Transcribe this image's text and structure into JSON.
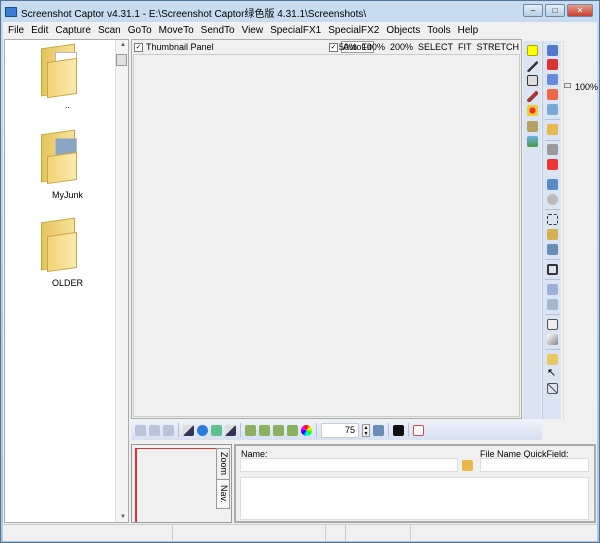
{
  "window": {
    "title": "Screenshot Captor v4.31.1 - E:\\Screenshot Captor绿色版 4.31.1\\Screenshots\\",
    "minimize": "–",
    "maximize": "□",
    "close": "✕"
  },
  "menu": [
    "File",
    "Edit",
    "Capture",
    "Scan",
    "GoTo",
    "MoveTo",
    "SendTo",
    "View",
    "SpecialFX1",
    "SpecialFX2",
    "Objects",
    "Tools",
    "Help"
  ],
  "folders": [
    "..",
    "MyJunk",
    "OLDER"
  ],
  "main": {
    "thumbnail_panel": "Thumbnail Panel",
    "thumbnail_checked": true,
    "autofit": "AutoFit",
    "autofit_checked": true,
    "zoom_options": [
      "50%",
      "100%",
      "200%",
      "SELECT",
      "FIT",
      "STRETCH"
    ]
  },
  "zoom_slider": {
    "label": "100%",
    "value": 100
  },
  "bottom_toolbar": {
    "zoom_value": "75"
  },
  "nav_tabs": [
    "Zoom",
    "Nav."
  ],
  "info": {
    "name_label": "Name:",
    "name_value": "",
    "quickfield_label": "File Name QuickField:",
    "quickfield_value": ""
  },
  "colors": {
    "highlight_swatch": "#ffff00",
    "nav_frame": "#dd3333"
  }
}
